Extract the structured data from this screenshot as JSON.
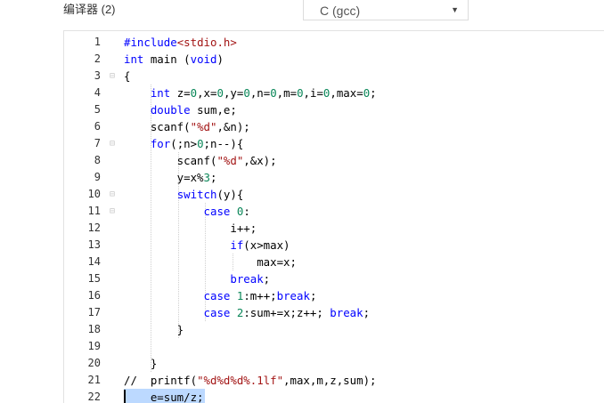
{
  "header": {
    "compiler_label": "编译器 (2)",
    "language_select": {
      "value": "C (gcc)",
      "arrow": "▼"
    }
  },
  "editor": {
    "lines": [
      {
        "n": "1",
        "fold": "",
        "tokens": [
          [
            "kw",
            "#include"
          ],
          [
            "str",
            "<stdio.h>"
          ]
        ]
      },
      {
        "n": "2",
        "fold": "",
        "tokens": [
          [
            "kw",
            "int"
          ],
          [
            "t",
            " main ("
          ],
          [
            "kw",
            "void"
          ],
          [
            "t",
            ")"
          ]
        ]
      },
      {
        "n": "3",
        "fold": "⊟",
        "tokens": [
          [
            "t",
            "{"
          ]
        ]
      },
      {
        "n": "4",
        "fold": "",
        "tokens": [
          [
            "t",
            "    "
          ],
          [
            "kw",
            "int"
          ],
          [
            "t",
            " z="
          ],
          [
            "num",
            "0"
          ],
          [
            "t",
            ",x="
          ],
          [
            "num",
            "0"
          ],
          [
            "t",
            ",y="
          ],
          [
            "num",
            "0"
          ],
          [
            "t",
            ",n="
          ],
          [
            "num",
            "0"
          ],
          [
            "t",
            ",m="
          ],
          [
            "num",
            "0"
          ],
          [
            "t",
            ",i="
          ],
          [
            "num",
            "0"
          ],
          [
            "t",
            ",max="
          ],
          [
            "num",
            "0"
          ],
          [
            "t",
            ";"
          ]
        ]
      },
      {
        "n": "5",
        "fold": "",
        "tokens": [
          [
            "t",
            "    "
          ],
          [
            "kw",
            "double"
          ],
          [
            "t",
            " sum,e;"
          ]
        ]
      },
      {
        "n": "6",
        "fold": "",
        "tokens": [
          [
            "t",
            "    scanf("
          ],
          [
            "str",
            "\"%d\""
          ],
          [
            "t",
            ",&n);"
          ]
        ]
      },
      {
        "n": "7",
        "fold": "⊟",
        "tokens": [
          [
            "t",
            "    "
          ],
          [
            "kw",
            "for"
          ],
          [
            "t",
            "(;n>"
          ],
          [
            "num",
            "0"
          ],
          [
            "t",
            ";n--){"
          ]
        ]
      },
      {
        "n": "8",
        "fold": "",
        "tokens": [
          [
            "t",
            "        scanf("
          ],
          [
            "str",
            "\"%d\""
          ],
          [
            "t",
            ",&x);"
          ]
        ]
      },
      {
        "n": "9",
        "fold": "",
        "tokens": [
          [
            "t",
            "        y=x%"
          ],
          [
            "num",
            "3"
          ],
          [
            "t",
            ";"
          ]
        ]
      },
      {
        "n": "10",
        "fold": "⊟",
        "tokens": [
          [
            "t",
            "        "
          ],
          [
            "kw",
            "switch"
          ],
          [
            "t",
            "(y){"
          ]
        ]
      },
      {
        "n": "11",
        "fold": "⊟",
        "tokens": [
          [
            "t",
            "            "
          ],
          [
            "kw",
            "case"
          ],
          [
            "t",
            " "
          ],
          [
            "num",
            "0"
          ],
          [
            "t",
            ":"
          ]
        ]
      },
      {
        "n": "12",
        "fold": "",
        "tokens": [
          [
            "t",
            "                i++;"
          ]
        ]
      },
      {
        "n": "13",
        "fold": "",
        "tokens": [
          [
            "t",
            "                "
          ],
          [
            "kw",
            "if"
          ],
          [
            "t",
            "(x>max)"
          ]
        ]
      },
      {
        "n": "14",
        "fold": "",
        "tokens": [
          [
            "t",
            "                    max=x;"
          ]
        ]
      },
      {
        "n": "15",
        "fold": "",
        "tokens": [
          [
            "t",
            "                "
          ],
          [
            "kw",
            "break"
          ],
          [
            "t",
            ";"
          ]
        ]
      },
      {
        "n": "16",
        "fold": "",
        "tokens": [
          [
            "t",
            "            "
          ],
          [
            "kw",
            "case"
          ],
          [
            "t",
            " "
          ],
          [
            "num",
            "1"
          ],
          [
            "t",
            ":m++;"
          ],
          [
            "kw",
            "break"
          ],
          [
            "t",
            ";"
          ]
        ]
      },
      {
        "n": "17",
        "fold": "",
        "tokens": [
          [
            "t",
            "            "
          ],
          [
            "kw",
            "case"
          ],
          [
            "t",
            " "
          ],
          [
            "num",
            "2"
          ],
          [
            "t",
            ":sum+=x;z++; "
          ],
          [
            "kw",
            "break"
          ],
          [
            "t",
            ";"
          ]
        ]
      },
      {
        "n": "18",
        "fold": "",
        "tokens": [
          [
            "t",
            "        }"
          ]
        ]
      },
      {
        "n": "19",
        "fold": "",
        "tokens": [
          [
            "t",
            ""
          ]
        ]
      },
      {
        "n": "20",
        "fold": "",
        "tokens": [
          [
            "t",
            "    }"
          ]
        ]
      },
      {
        "n": "21",
        "fold": "",
        "tokens": [
          [
            "t",
            "//  printf("
          ],
          [
            "str",
            "\"%d%d%d%.1lf\""
          ],
          [
            "t",
            ",max,m,z,sum);"
          ]
        ]
      },
      {
        "n": "22",
        "fold": "",
        "tokens": [
          [
            "t",
            "    e=sum/z;"
          ]
        ]
      }
    ]
  },
  "colors": {
    "keyword": "#0000ff",
    "string": "#a31515",
    "number": "#098658",
    "selection": "#bcd9ff"
  }
}
